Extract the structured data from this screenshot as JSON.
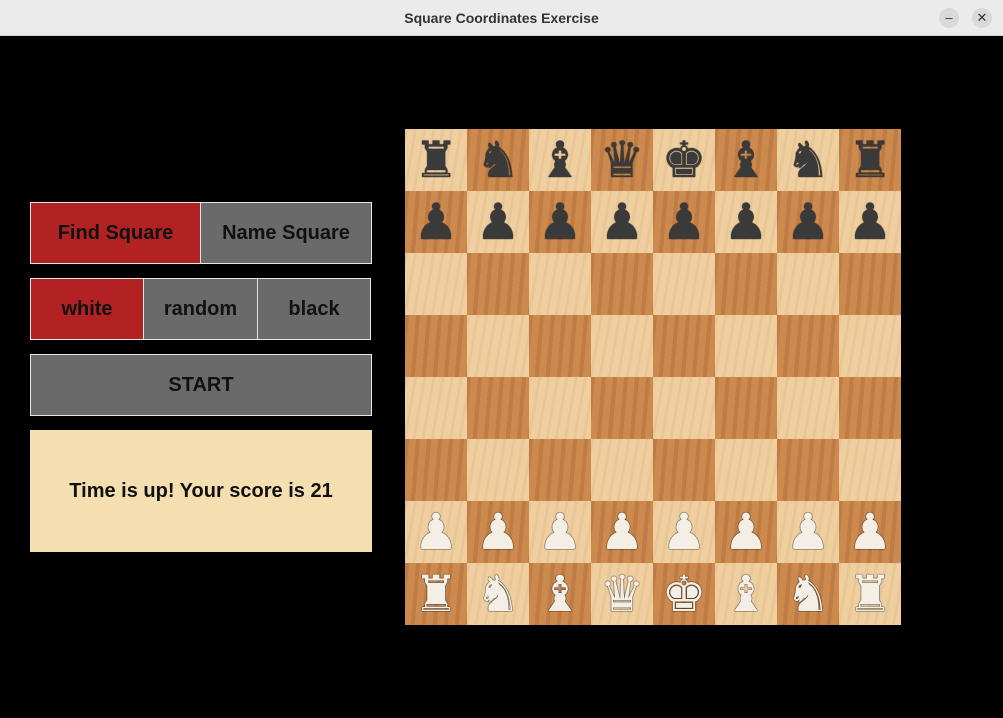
{
  "window": {
    "title": "Square Coordinates Exercise",
    "minimize_glyph": "–",
    "close_glyph": "✕"
  },
  "mode_buttons": {
    "find": "Find Square",
    "name": "Name Square",
    "active": "find"
  },
  "color_buttons": {
    "white": "white",
    "random": "random",
    "black": "black",
    "active": "white"
  },
  "start_button": "START",
  "message": "Time is up! Your score is 21",
  "colors": {
    "active": "#b22222",
    "inactive": "#6a6a6a",
    "message_bg": "#f5dfb1",
    "light_square": "#efcf9f",
    "dark_square": "#cd8a4f"
  },
  "board": {
    "orientation": "white",
    "rows": [
      [
        "bR",
        "bN",
        "bB",
        "bQ",
        "bK",
        "bB",
        "bN",
        "bR"
      ],
      [
        "bP",
        "bP",
        "bP",
        "bP",
        "bP",
        "bP",
        "bP",
        "bP"
      ],
      [
        "",
        "",
        "",
        "",
        "",
        "",
        "",
        ""
      ],
      [
        "",
        "",
        "",
        "",
        "",
        "",
        "",
        ""
      ],
      [
        "",
        "",
        "",
        "",
        "",
        "",
        "",
        ""
      ],
      [
        "",
        "",
        "",
        "",
        "",
        "",
        "",
        ""
      ],
      [
        "wP",
        "wP",
        "wP",
        "wP",
        "wP",
        "wP",
        "wP",
        "wP"
      ],
      [
        "wR",
        "wN",
        "wB",
        "wQ",
        "wK",
        "wB",
        "wN",
        "wR"
      ]
    ]
  }
}
